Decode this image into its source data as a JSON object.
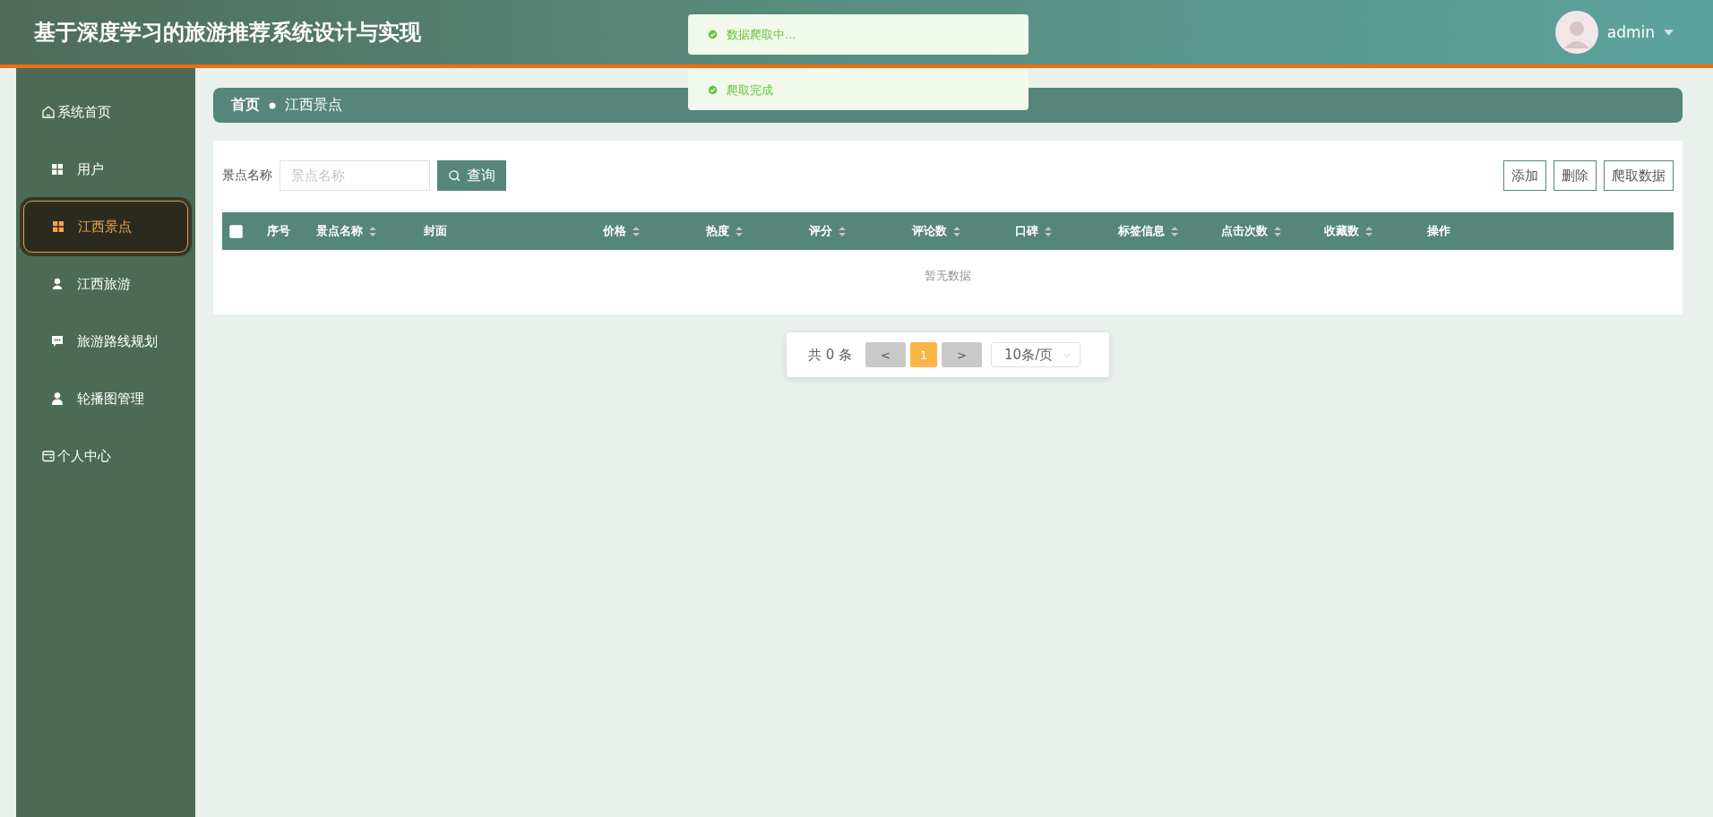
{
  "header": {
    "title": "基于深度学习的旅游推荐系统设计与实现",
    "user": "admin"
  },
  "toasts": [
    {
      "text": "数据爬取中...",
      "kind": "success"
    },
    {
      "text": "爬取完成",
      "kind": "success"
    }
  ],
  "sidebar": {
    "items": [
      {
        "label": "系统首页",
        "kind": "home",
        "selected": false
      },
      {
        "label": "用户",
        "kind": "grid",
        "selected": false
      },
      {
        "label": "江西景点",
        "kind": "grid",
        "selected": true
      },
      {
        "label": "江西旅游",
        "kind": "bust",
        "selected": false
      },
      {
        "label": "旅游路线规划",
        "kind": "chat",
        "selected": false
      },
      {
        "label": "轮播图管理",
        "kind": "person",
        "selected": false
      },
      {
        "label": "个人中心",
        "kind": "wallet",
        "selected": false
      }
    ]
  },
  "breadcrumb": [
    {
      "label": "首页"
    },
    {
      "label": "江西景点"
    }
  ],
  "search": {
    "label": "景点名称",
    "placeholder": "景点名称",
    "button": "查询"
  },
  "actions": [
    "添加",
    "删除",
    "爬取数据"
  ],
  "table": {
    "select_all_checked": false,
    "columns": [
      {
        "label": "序号",
        "kind": "plain"
      },
      {
        "label": "景点名称",
        "kind": "sortable"
      },
      {
        "label": "封面",
        "kind": "plain"
      },
      {
        "label": "价格",
        "kind": "sortable"
      },
      {
        "label": "热度",
        "kind": "sortable"
      },
      {
        "label": "评分",
        "kind": "sortable"
      },
      {
        "label": "评论数",
        "kind": "sortable"
      },
      {
        "label": "口碑",
        "kind": "sortable"
      },
      {
        "label": "标签信息",
        "kind": "sortable"
      },
      {
        "label": "点击次数",
        "kind": "sortable"
      },
      {
        "label": "收藏数",
        "kind": "sortable"
      },
      {
        "label": "操作",
        "kind": "plain"
      }
    ],
    "empty_text": "暂无数据"
  },
  "pagination": {
    "total": "共 0 条",
    "prev": "<",
    "pages": [
      {
        "label": "1",
        "selected": true
      }
    ],
    "next": ">",
    "page_size": "10条/页"
  }
}
